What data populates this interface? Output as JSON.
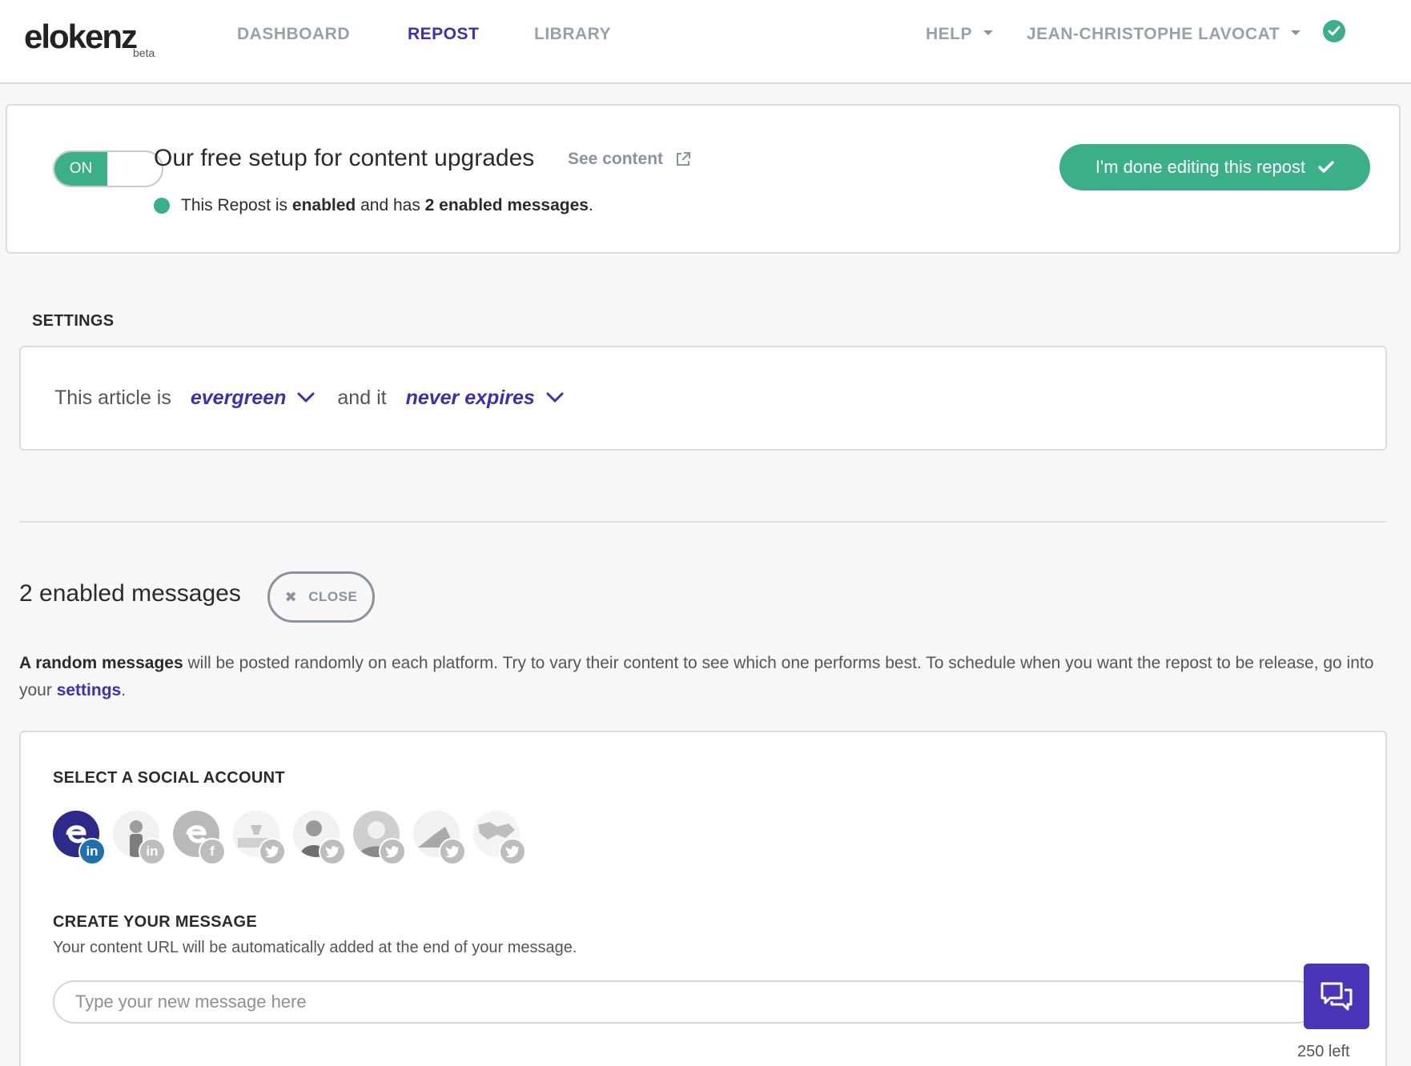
{
  "header": {
    "logo_text": "elokenz",
    "logo_badge": "beta",
    "nav": [
      {
        "label": "DASHBOARD",
        "active": false
      },
      {
        "label": "REPOST",
        "active": true
      },
      {
        "label": "LIBRARY",
        "active": false
      }
    ],
    "help_label": "HELP",
    "user_label": "JEAN-CHRISTOPHE LAVOCAT"
  },
  "repost": {
    "toggle_label": "ON",
    "title": "Our free setup for content upgrades",
    "see_content_label": "See content",
    "status_prefix": "This Repost is",
    "status_enabled": "enabled",
    "status_middle": "and has",
    "status_messages": "2 enabled messages",
    "status_suffix": ".",
    "done_label": "I'm done editing this repost"
  },
  "settings": {
    "section_label": "SETTINGS",
    "prefix": "This article is",
    "lifespan_value": "evergreen",
    "middle": "and it",
    "expiry_value": "never expires"
  },
  "messages": {
    "title": "2 enabled messages",
    "close_label": "CLOSE",
    "info_bold": "A random messages",
    "info_text": "will be posted randomly on each platform. Try to vary their content to see which one performs best. To schedule when you want the repost to be release, go into your",
    "info_link": "settings",
    "info_end": "."
  },
  "social": {
    "section_label": "SELECT A SOCIAL ACCOUNT",
    "accounts": [
      {
        "network": "linkedin",
        "network_glyph": "in",
        "selected": true
      },
      {
        "network": "linkedin",
        "network_glyph": "in",
        "selected": false
      },
      {
        "network": "facebook",
        "network_glyph": "f",
        "selected": false
      },
      {
        "network": "twitter",
        "network_glyph": "t",
        "selected": false
      },
      {
        "network": "twitter",
        "network_glyph": "t",
        "selected": false
      },
      {
        "network": "twitter",
        "network_glyph": "t",
        "selected": false
      },
      {
        "network": "twitter",
        "network_glyph": "t",
        "selected": false
      },
      {
        "network": "twitter",
        "network_glyph": "t",
        "selected": false
      }
    ]
  },
  "compose": {
    "section_label": "CREATE YOUR MESSAGE",
    "subtitle": "Your content URL will be automatically added at the end of your message.",
    "placeholder": "Type your new message here",
    "value": "",
    "chars_left": "250 left"
  },
  "colors": {
    "brand": "#3e2fb0",
    "success": "#3aaf88",
    "muted": "#8c929a"
  },
  "icons": {
    "status": "check-circle-icon",
    "external": "external-link-icon",
    "done": "checkmark-icon",
    "select": "chevron-down-icon",
    "close": "close-icon",
    "chat": "chat-bubbles-icon"
  }
}
